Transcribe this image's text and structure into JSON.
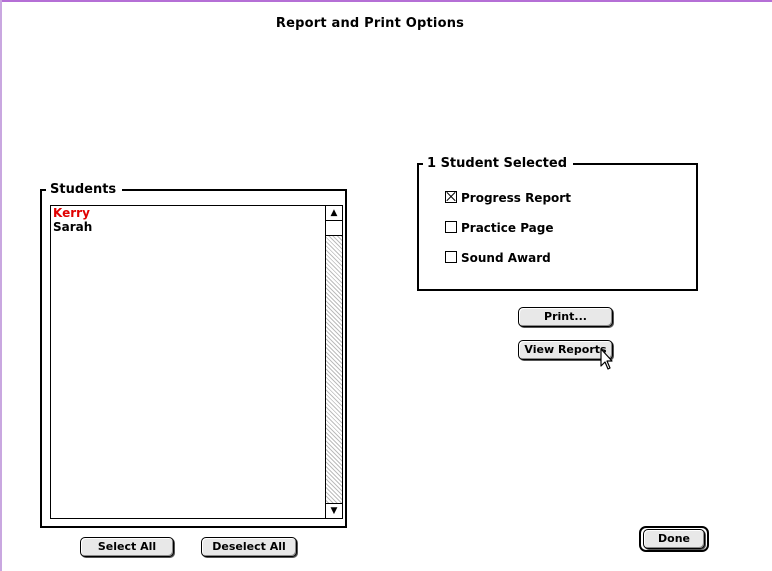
{
  "window": {
    "title": "Report and Print Options"
  },
  "students": {
    "legend": "Students",
    "items": [
      "Kerry",
      "Sarah"
    ],
    "selected_index": 0,
    "select_all_label": "Select All",
    "deselect_all_label": "Deselect All"
  },
  "selection": {
    "legend": "1 Student Selected",
    "options": [
      {
        "label": "Progress Report",
        "checked": true
      },
      {
        "label": "Practice Page",
        "checked": false
      },
      {
        "label": "Sound Award",
        "checked": false
      }
    ]
  },
  "actions": {
    "print_label": "Print...",
    "view_reports_label": "View Reports",
    "done_label": "Done"
  },
  "colors": {
    "selected_student": "#e00000",
    "window_frame": "#b56fd6"
  },
  "icons": {
    "scroll_up": "arrow-up-icon",
    "scroll_down": "arrow-down-icon",
    "cursor": "mouse-pointer-icon"
  }
}
